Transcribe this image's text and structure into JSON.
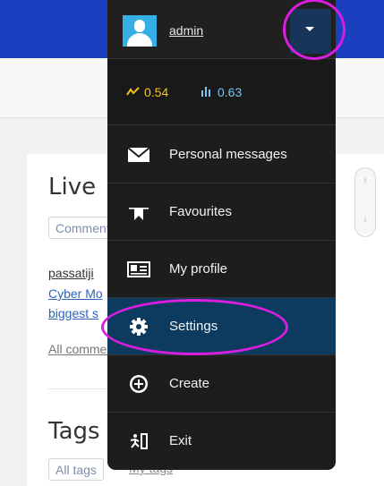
{
  "header": {
    "brand_color": "#1b3fbe"
  },
  "sidebar_widget": {
    "live_title": "Live",
    "tabs": [
      "Comments"
    ],
    "entry_user": "passatiji",
    "entry_link_line1": "Cyber Mo",
    "entry_link_line2": "biggest s",
    "all_comments": "All comments",
    "tags_title": "Tags",
    "tag_tabs": [
      "All tags",
      "My tags"
    ],
    "scroll_up": "↑",
    "scroll_down": "↓"
  },
  "user_menu": {
    "username": "admin",
    "toggle_icon": "caret-down-icon",
    "stats": {
      "rating": {
        "icon": "rating-icon",
        "value": "0.54",
        "color": "#f2c51c"
      },
      "skill": {
        "icon": "skill-bars-icon",
        "value": "0.63",
        "color": "#7fc4f2"
      }
    },
    "items": [
      {
        "icon": "envelope-icon",
        "label": "Personal messages"
      },
      {
        "icon": "bookmark-icon",
        "label": "Favourites"
      },
      {
        "icon": "id-card-icon",
        "label": "My profile"
      },
      {
        "icon": "gear-icon",
        "label": "Settings",
        "active": true
      },
      {
        "icon": "plus-circle-icon",
        "label": "Create"
      },
      {
        "icon": "exit-icon",
        "label": "Exit"
      }
    ]
  },
  "annotations": {
    "highlight_color": "#d91ee0"
  }
}
